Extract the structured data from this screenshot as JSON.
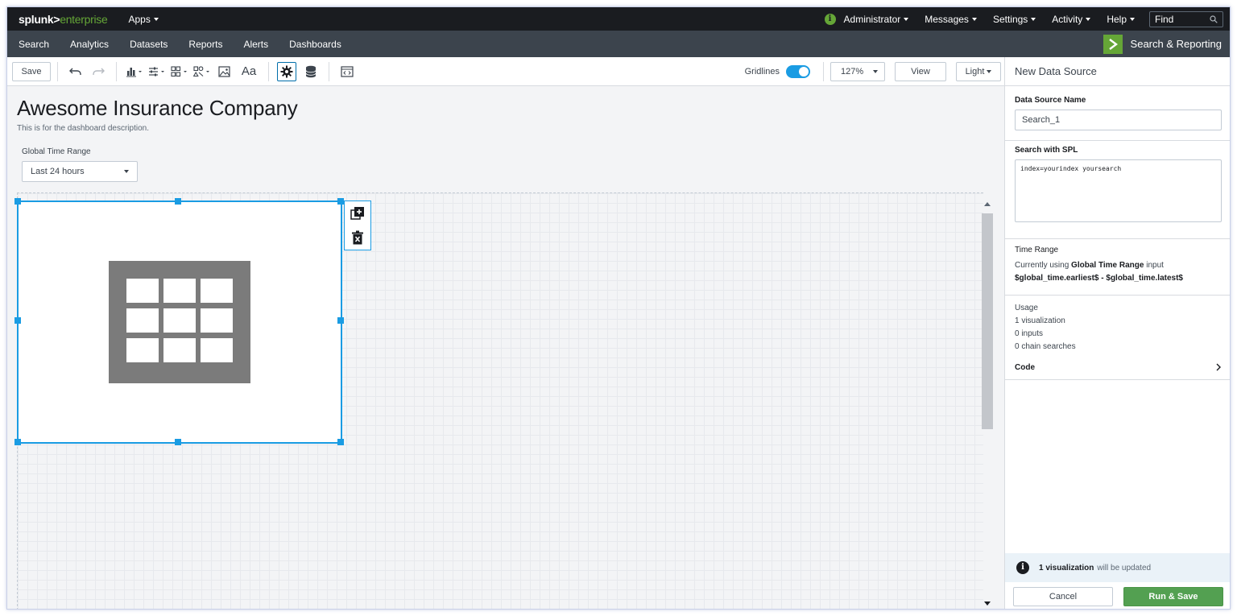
{
  "topbar": {
    "logo_brand": "splunk>",
    "logo_product": "enterprise",
    "apps_label": "Apps",
    "status_icon_glyph": "i",
    "items": [
      "Administrator",
      "Messages",
      "Settings",
      "Activity",
      "Help"
    ],
    "find_placeholder": "Find"
  },
  "appbar": {
    "nav": [
      "Search",
      "Analytics",
      "Datasets",
      "Reports",
      "Alerts",
      "Dashboards"
    ],
    "app_title": "Search & Reporting"
  },
  "toolbar": {
    "save_label": "Save",
    "text_tool_label": "Aa",
    "gridlines_label": "Gridlines",
    "gridlines_on": true,
    "zoom_value": "127%",
    "view_label": "View",
    "theme_label": "Light"
  },
  "dashboard": {
    "title": "Awesome Insurance Company",
    "description": "This is for the dashboard description.",
    "time_input_label": "Global Time Range",
    "time_input_value": "Last 24 hours"
  },
  "right_panel": {
    "header": "New Data Source",
    "name_label": "Data Source Name",
    "name_value": "Search_1",
    "spl_label": "Search with SPL",
    "spl_value": "index=yourindex yoursearch",
    "time_range_label": "Time Range",
    "time_range_prefix": "Currently using",
    "time_range_input_name": "Global Time Range",
    "time_range_suffix": "input",
    "time_range_tokens": "$global_time.earliest$ - $global_time.latest$",
    "usage_label": "Usage",
    "usage_items": [
      "1 visualization",
      "0 inputs",
      "0 chain searches"
    ],
    "code_label": "Code",
    "notice_icon_glyph": "i",
    "notice_bold": "1 visualization",
    "notice_rest": "will be updated",
    "cancel_label": "Cancel",
    "run_save_label": "Run & Save"
  },
  "colors": {
    "topbar_bg": "#1a1c20",
    "appbar_bg": "#3c444d",
    "brand_green": "#65a637",
    "selection_blue": "#1a9ce3",
    "run_button_green": "#53a051"
  }
}
